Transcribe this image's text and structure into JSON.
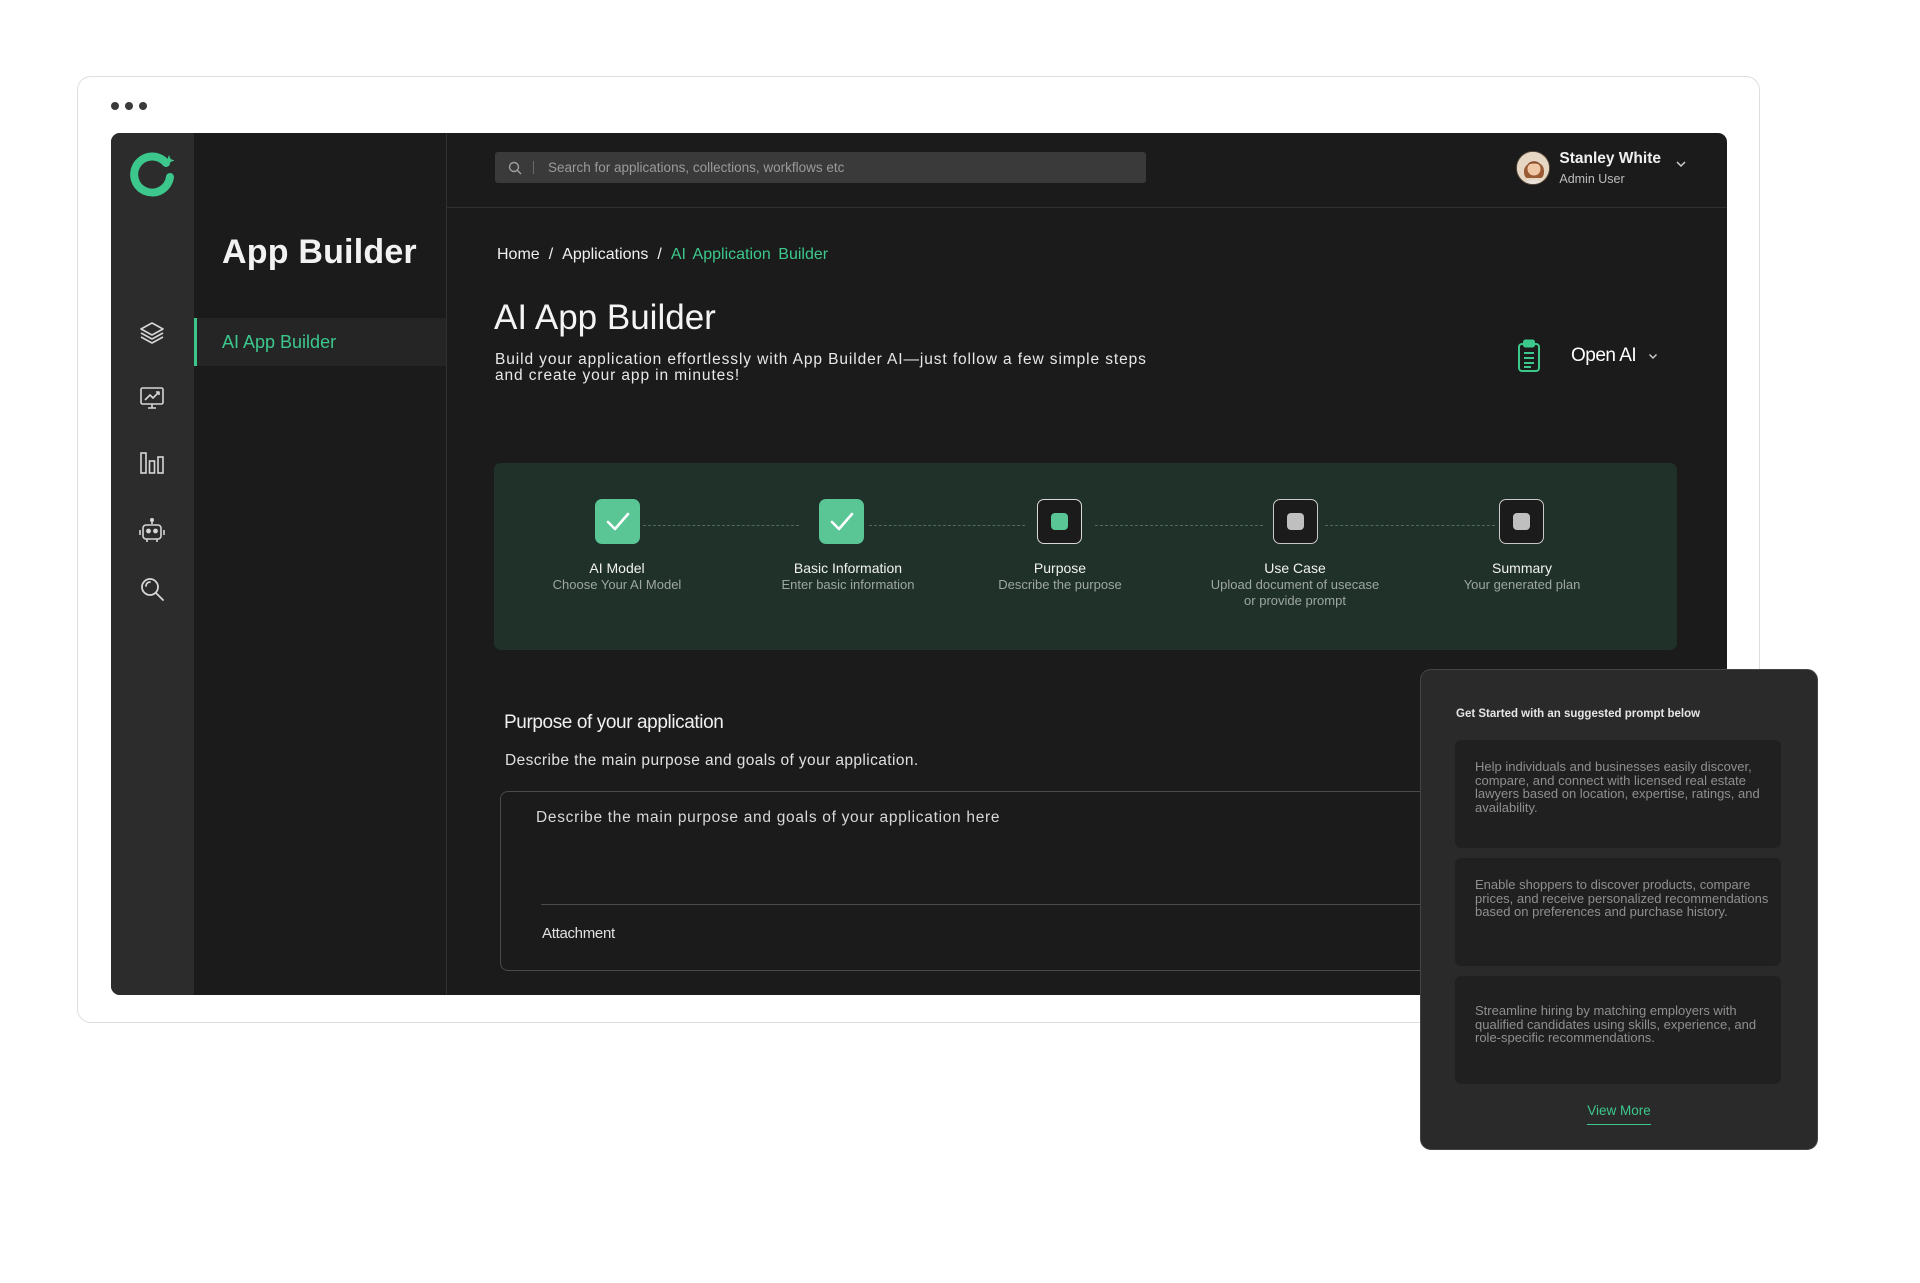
{
  "sidebar": {
    "icons": [
      "layers-icon",
      "analytics-monitor-icon",
      "bar-chart-icon",
      "robot-icon",
      "search-icon"
    ]
  },
  "panel": {
    "title": "App Builder",
    "items": [
      {
        "label": "AI App Builder",
        "active": true
      }
    ]
  },
  "topbar": {
    "search_placeholder": "Search for applications, collections, workflows etc",
    "user_name": "Stanley White",
    "user_role": "Admin User"
  },
  "breadcrumb": {
    "home": "Home",
    "applications": "Applications",
    "current": "AI Application Builder",
    "separator": "/"
  },
  "page": {
    "title": "AI App Builder",
    "description": "Build your application effortlessly with App Builder AI—just follow a few simple steps and create your app in minutes!",
    "model_label": "Open AI"
  },
  "steps": [
    {
      "label": "AI Model",
      "sub": "Choose Your AI Model",
      "status": "done"
    },
    {
      "label": "Basic Information",
      "sub": "Enter basic information",
      "status": "done"
    },
    {
      "label": "Purpose",
      "sub": "Describe the purpose",
      "status": "active"
    },
    {
      "label": "Use Case",
      "sub": "Upload document of usecase or provide prompt",
      "status": "pending"
    },
    {
      "label": "Summary",
      "sub": "Your generated plan",
      "status": "pending"
    }
  ],
  "purpose": {
    "title": "Purpose of your application",
    "description": "Describe the main purpose and goals of your application.",
    "placeholder": "Describe the main purpose and goals of your application here",
    "attachment_label": "Attachment"
  },
  "suggestions": {
    "title": "Get Started with an suggested prompt below",
    "items": [
      "Help individuals and businesses easily discover, compare, and connect with licensed real estate lawyers based on location, expertise, ratings, and availability.",
      "Enable shoppers to discover products, compare prices, and receive personalized recommendations based on preferences and purchase history.",
      "Streamline hiring by matching employers with qualified candidates using skills, experience, and role-specific recommendations."
    ],
    "view_more": "View More"
  },
  "colors": {
    "accent": "#3cc88d",
    "background": "#1b1b1b",
    "rail": "#2c2c2c",
    "stepper_bg": "#1f3129"
  }
}
